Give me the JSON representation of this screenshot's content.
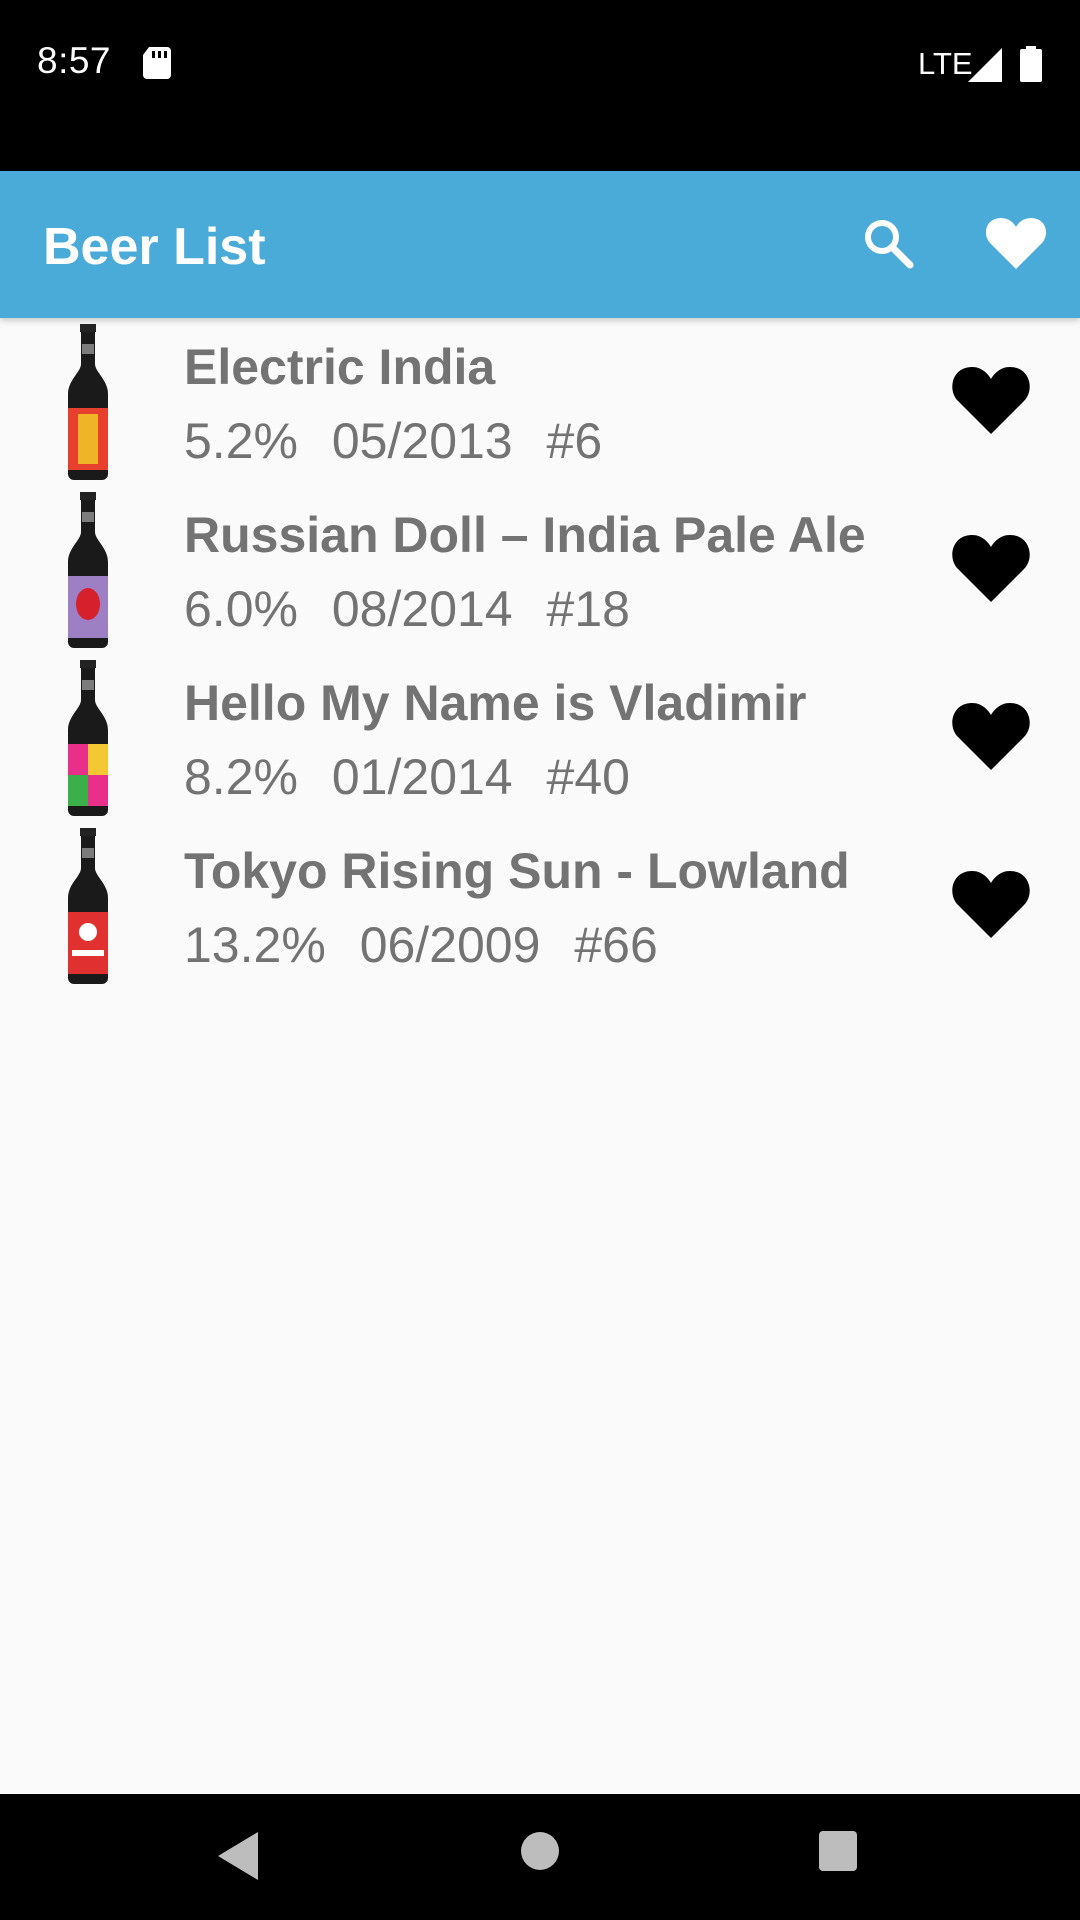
{
  "status_bar": {
    "time": "8:57",
    "network": "LTE",
    "icons": [
      "sd-card-icon",
      "signal-icon",
      "battery-icon"
    ]
  },
  "app_bar": {
    "title": "Beer List",
    "background": "#4aabd8",
    "actions": [
      "search-icon",
      "heart-icon"
    ]
  },
  "beers": [
    {
      "name": "Electric India",
      "abv": "5.2%",
      "date": "05/2013",
      "id": "#6",
      "label_colors": [
        "#e8402f",
        "#f0b429"
      ]
    },
    {
      "name": "Russian Doll – India Pale Ale",
      "abv": "6.0%",
      "date": "08/2014",
      "id": "#18",
      "label_colors": [
        "#9d7fc4",
        "#d6202c"
      ]
    },
    {
      "name": "Hello My Name is Vladimir",
      "abv": "8.2%",
      "date": "01/2014",
      "id": "#40",
      "label_colors": [
        "#e8308a",
        "#f4c832"
      ]
    },
    {
      "name": "Tokyo Rising Sun - Lowland",
      "abv": "13.2%",
      "date": "06/2009",
      "id": "#66",
      "label_colors": [
        "#e03030",
        "#ffffff"
      ]
    }
  ],
  "nav_bar": {
    "icons": [
      "back-icon",
      "home-icon",
      "recents-icon"
    ]
  }
}
